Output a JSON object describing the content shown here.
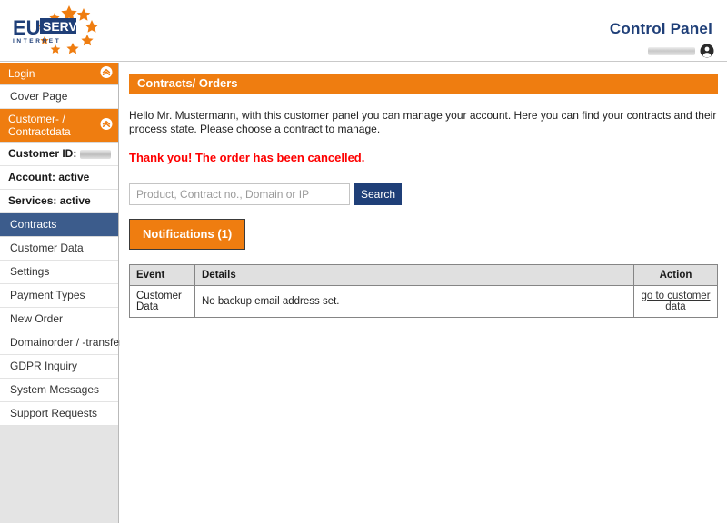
{
  "header": {
    "logo_primary": "EU",
    "logo_secondary": "SERV",
    "logo_tagline": "I N T E R N E T",
    "title": "Control Panel",
    "username_redacted": "",
    "user_icon": "user-account-icon"
  },
  "sidebar": {
    "sections": [
      {
        "type": "section",
        "label": "Login",
        "icon": "collapse-chevron-up-icon",
        "name": "sidebar-section-login"
      },
      {
        "type": "item",
        "label": "Cover Page",
        "name": "sidebar-item-cover-page",
        "style": "normal"
      },
      {
        "type": "section",
        "label": "Customer- / Contractdata",
        "icon": "collapse-chevron-up-icon",
        "name": "sidebar-section-customer-contractdata"
      },
      {
        "type": "item",
        "label": "Customer ID:",
        "name": "sidebar-item-customer-id",
        "style": "bold-redacted"
      },
      {
        "type": "item",
        "label": "Account: active",
        "name": "sidebar-item-account-status",
        "style": "bold"
      },
      {
        "type": "item",
        "label": "Services: active",
        "name": "sidebar-item-services-status",
        "style": "bold"
      },
      {
        "type": "item",
        "label": "Contracts",
        "name": "sidebar-item-contracts",
        "style": "active"
      },
      {
        "type": "item",
        "label": "Customer Data",
        "name": "sidebar-item-customer-data",
        "style": "normal"
      },
      {
        "type": "item",
        "label": "Settings",
        "name": "sidebar-item-settings",
        "style": "normal"
      },
      {
        "type": "item",
        "label": "Payment Types",
        "name": "sidebar-item-payment-types",
        "style": "normal"
      },
      {
        "type": "item",
        "label": "New Order",
        "name": "sidebar-item-new-order",
        "style": "normal"
      },
      {
        "type": "item",
        "label": "Domainorder / -transfer",
        "name": "sidebar-item-domainorder-transfer",
        "style": "normal"
      },
      {
        "type": "item",
        "label": "GDPR Inquiry",
        "name": "sidebar-item-gdpr-inquiry",
        "style": "normal"
      },
      {
        "type": "item",
        "label": "System Messages",
        "name": "sidebar-item-system-messages",
        "style": "normal"
      },
      {
        "type": "item",
        "label": "Support Requests",
        "name": "sidebar-item-support-requests",
        "style": "normal"
      }
    ]
  },
  "main": {
    "page_title": "Contracts/ Orders",
    "intro_text": "Hello Mr. Mustermann, with this customer panel you can manage your account. Here you can find your contracts and their process state. Please choose a contract to manage.",
    "flash_message": "Thank you! The order has been cancelled.",
    "search": {
      "placeholder": "Product, Contract no., Domain or IP",
      "value": "",
      "button_label": "Search"
    },
    "tabs": [
      {
        "label": "Notifications (1)",
        "active": true
      }
    ],
    "table": {
      "columns": [
        "Event",
        "Details",
        "Action"
      ],
      "rows": [
        {
          "event": "Customer Data",
          "details": "No backup email address set.",
          "action": "go to customer data"
        }
      ]
    }
  },
  "colors": {
    "orange": "#ef7d10",
    "navy": "#1f3f78",
    "active_nav": "#3c5c8c",
    "flash_red": "#fe0000",
    "sidebar_bg": "#e4e4e4",
    "table_header": "#e0e0e0"
  }
}
